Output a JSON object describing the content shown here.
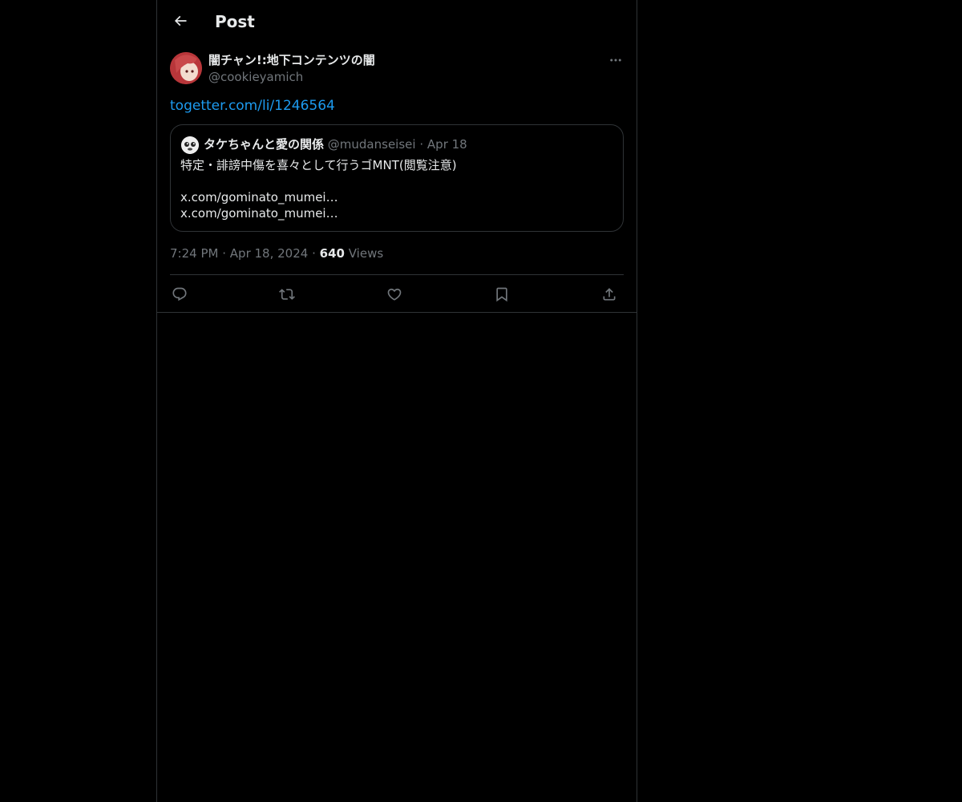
{
  "header": {
    "title": "Post",
    "back_icon": "arrow-left-icon"
  },
  "post": {
    "author": {
      "display_name": "闇チャン!:地下コンテンツの闇",
      "handle": "@cookieyamich"
    },
    "link_text": "togetter.com/li/1246564",
    "quote": {
      "display_name": "タケちゃんと愛の関係",
      "handle": "@mudanseisei",
      "separator": "·",
      "date": "Apr 18",
      "text": "特定・誹謗中傷を喜々として行うゴMNT(閲覧注意)",
      "urls": [
        "x.com/gominato_mumei…",
        "x.com/gominato_mumei…"
      ]
    },
    "meta": {
      "time": "7:24 PM",
      "separator": "·",
      "date": "Apr 18, 2024",
      "views_count": "640",
      "views_label": "Views"
    }
  },
  "actions": [
    {
      "name": "reply",
      "icon": "reply-icon"
    },
    {
      "name": "repost",
      "icon": "repost-icon"
    },
    {
      "name": "like",
      "icon": "heart-icon"
    },
    {
      "name": "bookmark",
      "icon": "bookmark-icon"
    },
    {
      "name": "share",
      "icon": "share-icon"
    }
  ],
  "colors": {
    "background": "#000000",
    "text": "#e7e9ea",
    "secondary": "#71767b",
    "link": "#1d9bf0",
    "border": "#2f3336"
  }
}
